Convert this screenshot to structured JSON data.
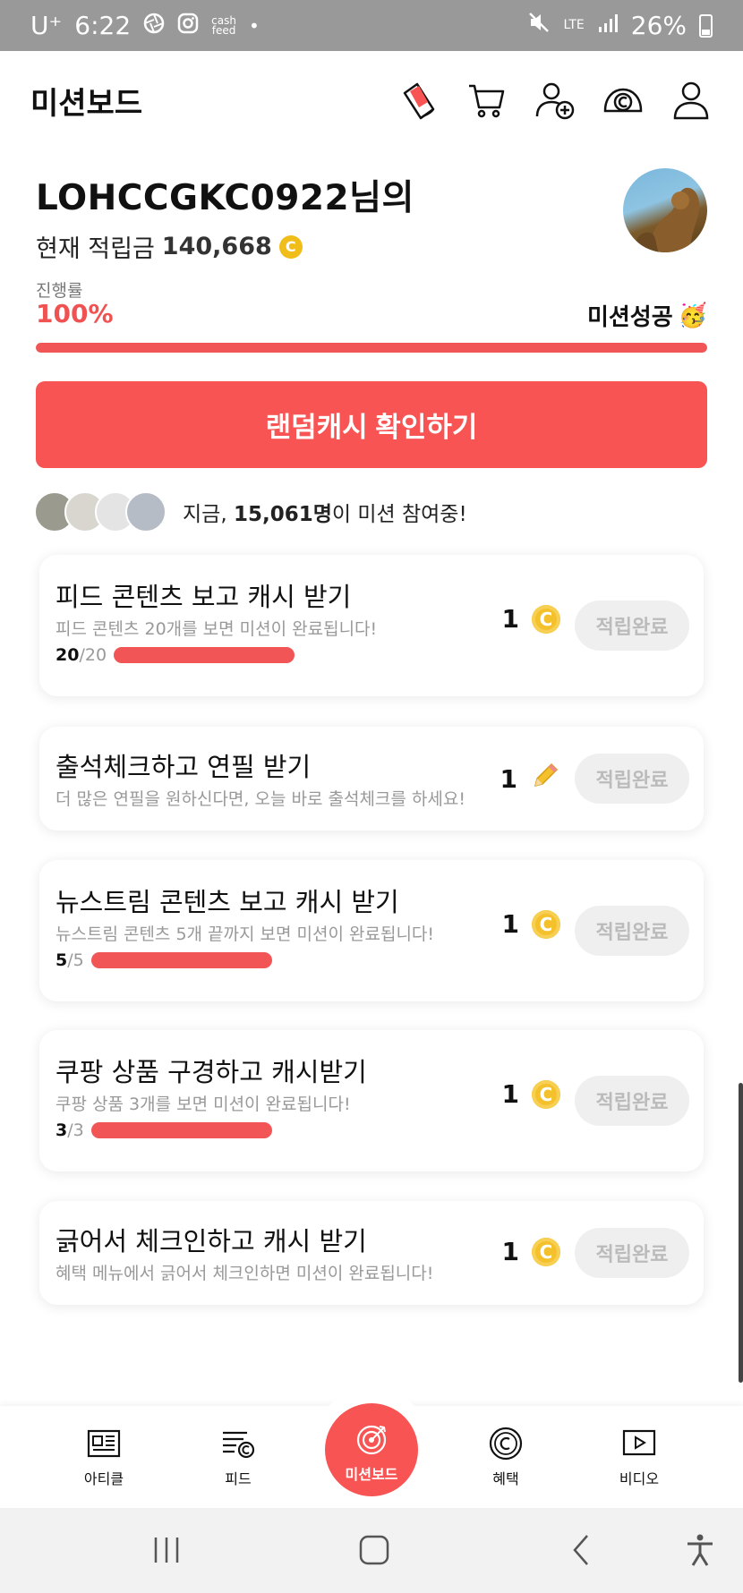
{
  "status": {
    "carrier": "U⁺",
    "time": "6:22",
    "app_badge": "cash\nfeed",
    "dot": "•",
    "network": "LTE",
    "battery": "26%"
  },
  "appbar": {
    "title": "미션보드",
    "icons": [
      "sticker-icon",
      "cart-icon",
      "add-friend-icon",
      "cash-icon",
      "profile-icon"
    ]
  },
  "user": {
    "name": "LOHCCGKC0922님의",
    "points_label": "현재 적립금",
    "points_value": "140,668",
    "coin_symbol": "C"
  },
  "progress": {
    "label": "진행률",
    "percent_text": "100%",
    "percent": 100,
    "success_label": "미션성공",
    "success_emoji": "🥳"
  },
  "cta": {
    "label": "랜덤캐시 확인하기"
  },
  "participants": {
    "prefix": "지금, ",
    "count": "15,061명",
    "suffix": "이 미션 참여중!"
  },
  "missions": [
    {
      "title": "피드 콘텐츠 보고 캐시 받기",
      "desc": "피드 콘텐츠 20개를 보면 미션이 완료됩니다!",
      "done": "20",
      "total": "/20",
      "fraction": 1,
      "reward": "1",
      "reward_type": "coin",
      "button": "적립완료"
    },
    {
      "title": "출석체크하고 연필 받기",
      "desc": "더 많은 연필을 원하신다면, 오늘 바로 출석체크를 하세요!",
      "reward": "1",
      "reward_type": "pencil",
      "button": "적립완료"
    },
    {
      "title": "뉴스트림 콘텐츠 보고 캐시 받기",
      "desc": "뉴스트림 콘텐츠 5개 끝까지 보면 미션이 완료됩니다!",
      "done": "5",
      "total": "/5",
      "fraction": 1,
      "reward": "1",
      "reward_type": "coin",
      "button": "적립완료"
    },
    {
      "title": "쿠팡 상품 구경하고 캐시받기",
      "desc": "쿠팡 상품 3개를 보면 미션이 완료됩니다!",
      "done": "3",
      "total": "/3",
      "fraction": 1,
      "reward": "1",
      "reward_type": "coin",
      "button": "적립완료"
    },
    {
      "title": "긁어서 체크인하고 캐시 받기",
      "desc": "혜택 메뉴에서 긁어서 체크인하면 미션이 완료됩니다!",
      "reward": "1",
      "reward_type": "coin",
      "button": "적립완료"
    }
  ],
  "bottom_nav": {
    "article": "아티클",
    "feed": "피드",
    "missionboard": "미션보드",
    "benefits": "혜택",
    "video": "비디오"
  },
  "colors": {
    "accent": "#f85453",
    "progress": "#f25555",
    "coin": "#f4c12c"
  }
}
